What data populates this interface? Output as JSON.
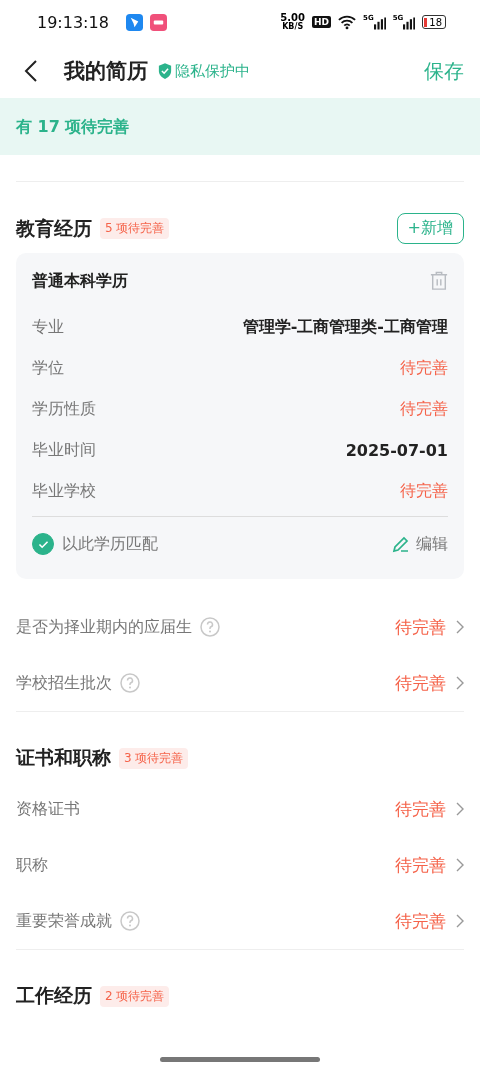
{
  "status_bar": {
    "time": "19:13:18",
    "speed_value": "5.00",
    "speed_unit": "KB/S",
    "hd": "HD",
    "network_1": "5G",
    "network_2": "5G",
    "battery": "18"
  },
  "header": {
    "title": "我的简历",
    "privacy": "隐私保护中",
    "save": "保存"
  },
  "banner": "有 17 项待完善",
  "education": {
    "title": "教育经历",
    "badge": "5 项待完善",
    "add": "+新增",
    "card": {
      "title": "普通本科学历",
      "fields": [
        {
          "label": "专业",
          "value": "管理学-工商管理类-工商管理",
          "pending": false
        },
        {
          "label": "学位",
          "value": "待完善",
          "pending": true
        },
        {
          "label": "学历性质",
          "value": "待完善",
          "pending": true
        },
        {
          "label": "毕业时间",
          "value": "2025-07-01",
          "pending": false
        },
        {
          "label": "毕业学校",
          "value": "待完善",
          "pending": true
        }
      ],
      "match": {
        "label": "以此学历匹配",
        "checked": true
      },
      "edit": "编辑"
    },
    "rows": [
      {
        "label": "是否为择业期内的应届生",
        "help": true,
        "value": "待完善"
      },
      {
        "label": "学校招生批次",
        "help": true,
        "value": "待完善"
      }
    ]
  },
  "certificates": {
    "title": "证书和职称",
    "badge": "3 项待完善",
    "rows": [
      {
        "label": "资格证书",
        "help": false,
        "value": "待完善"
      },
      {
        "label": "职称",
        "help": false,
        "value": "待完善"
      },
      {
        "label": "重要荣誉成就",
        "help": true,
        "value": "待完善"
      }
    ]
  },
  "work": {
    "title": "工作经历",
    "badge": "2 项待完善"
  }
}
